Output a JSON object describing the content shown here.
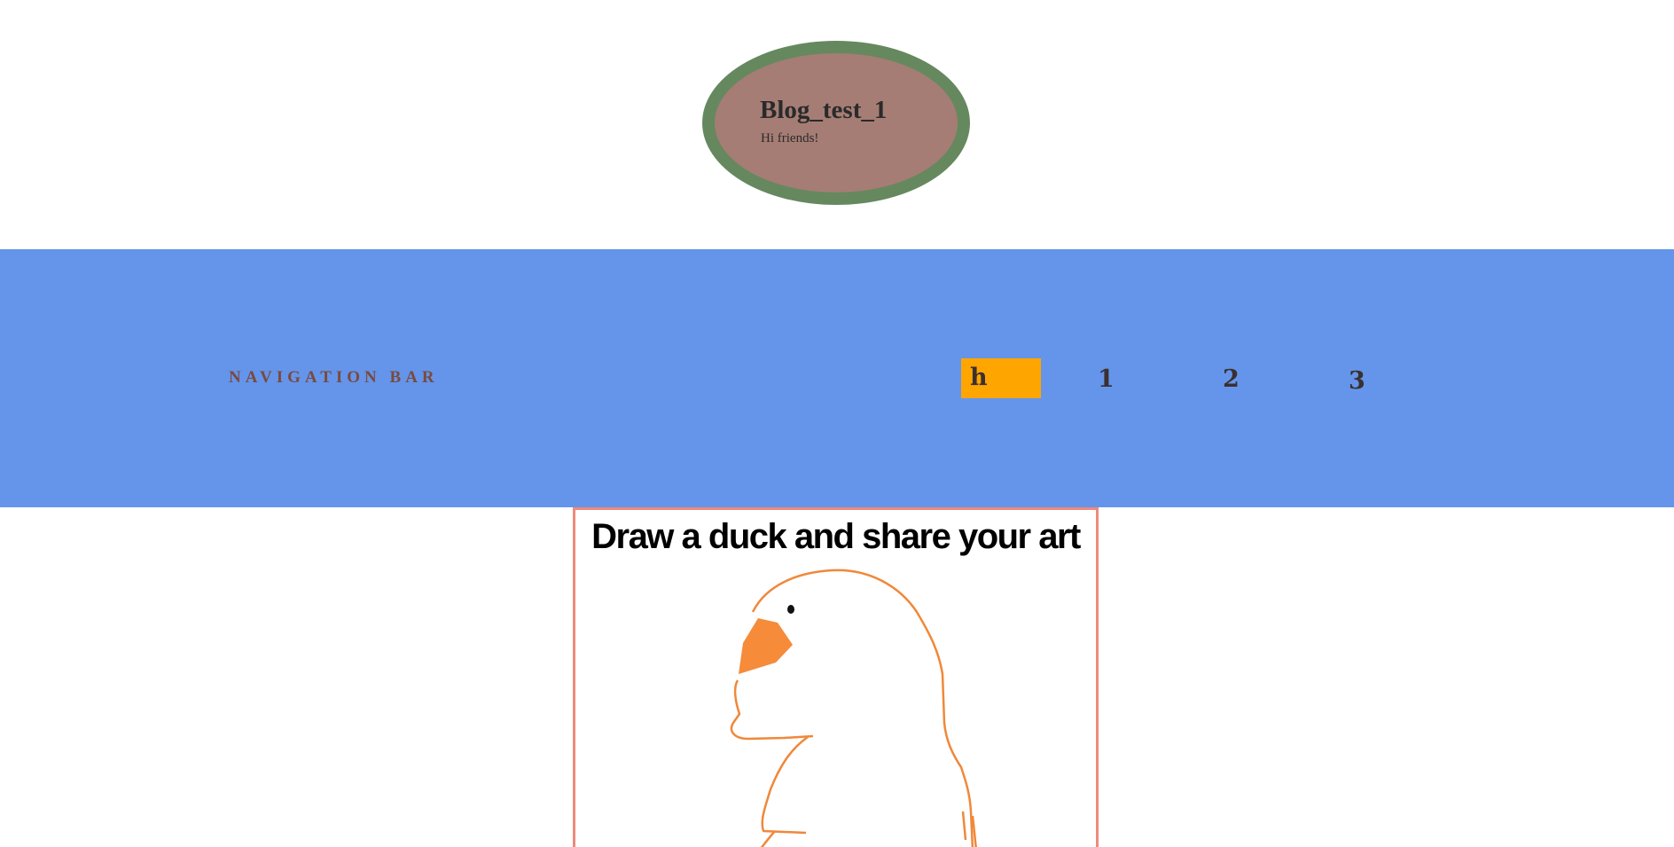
{
  "header": {
    "title": "Blog_test_1",
    "subtitle": "Hi friends!"
  },
  "nav": {
    "title": "NAVIGATION BAR",
    "items": [
      {
        "label": "h",
        "active": true
      },
      {
        "label": "1",
        "active": false
      },
      {
        "label": "2",
        "active": false
      },
      {
        "label": "3",
        "active": false
      }
    ]
  },
  "post": {
    "heading": "Draw a duck and share your art"
  },
  "colors": {
    "page_background": "#ffffff",
    "logo_fill": "#a57d74",
    "logo_border": "#66885f",
    "navbar": "#6495ea",
    "nav_title": "#7a4a3f",
    "nav_active": "#ffa500",
    "card_border": "#ee8a7b",
    "duck_outline": "#f0883a",
    "duck_beak": "#f68b3a"
  },
  "icons": {
    "artwork": "duck-drawing"
  }
}
